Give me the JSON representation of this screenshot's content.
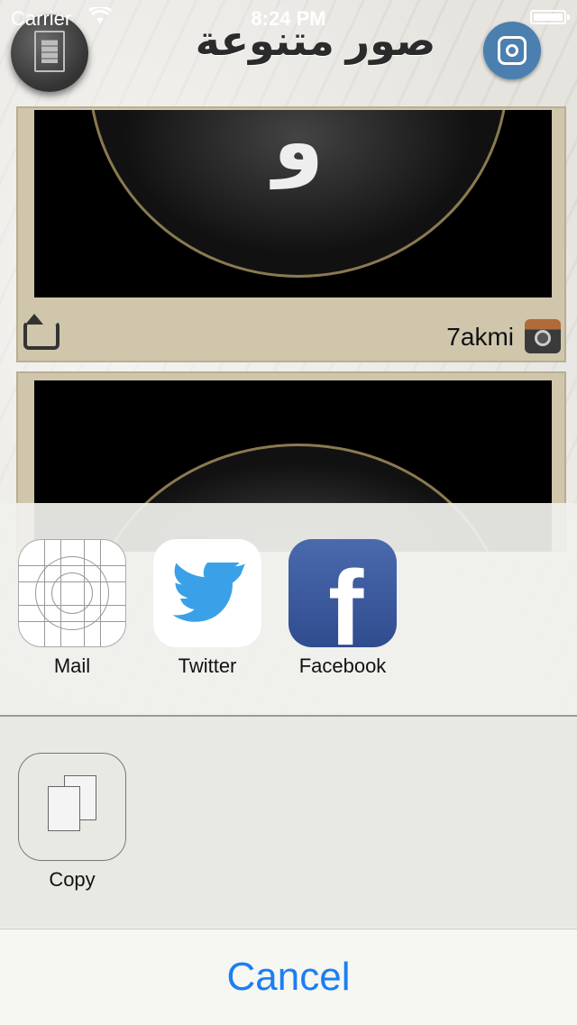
{
  "status_bar": {
    "carrier": "Carrier",
    "time": "8:24 PM"
  },
  "header": {
    "title": "صور متنوعة",
    "left_icon": "document-icon",
    "right_icon": "instagram-icon"
  },
  "feed": {
    "cards": [
      {
        "letter": "و",
        "username": "7akmi"
      },
      {
        "letter": "",
        "username": ""
      }
    ]
  },
  "share_sheet": {
    "share_items": [
      {
        "label": "Mail",
        "icon": "mail-icon"
      },
      {
        "label": "Twitter",
        "icon": "twitter-icon"
      },
      {
        "label": "Facebook",
        "icon": "facebook-icon"
      }
    ],
    "action_items": [
      {
        "label": "Copy",
        "icon": "copy-icon"
      }
    ],
    "cancel_label": "Cancel"
  },
  "colors": {
    "accent": "#1b7ff2",
    "facebook": "#3b5998",
    "twitter": "#55acee"
  }
}
